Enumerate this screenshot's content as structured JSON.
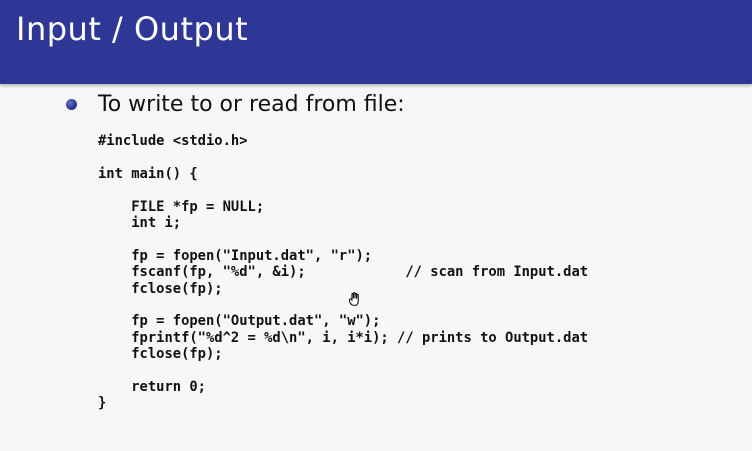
{
  "slide": {
    "title": "Input / Output",
    "bullet": "To write to or read from file:",
    "code_lines": [
      "#include <stdio.h>",
      "",
      "int main() {",
      "",
      "    FILE *fp = NULL;",
      "    int i;",
      "",
      "    fp = fopen(\"Input.dat\", \"r\");",
      "    fscanf(fp, \"%d\", &i);            // scan from Input.dat",
      "    fclose(fp);",
      "",
      "    fp = fopen(\"Output.dat\", \"w\");",
      "    fprintf(\"%d^2 = %d\\n\", i, i*i); // prints to Output.dat",
      "    fclose(fp);",
      "",
      "    return 0;",
      "}"
    ]
  },
  "icons": {
    "bullet": "bullet-dot-icon",
    "cursor": "hand-cursor-icon"
  },
  "colors": {
    "title_bar": "#2e3796",
    "title_text": "#ffffff",
    "background": "#f7f7f8",
    "text": "#111111"
  }
}
